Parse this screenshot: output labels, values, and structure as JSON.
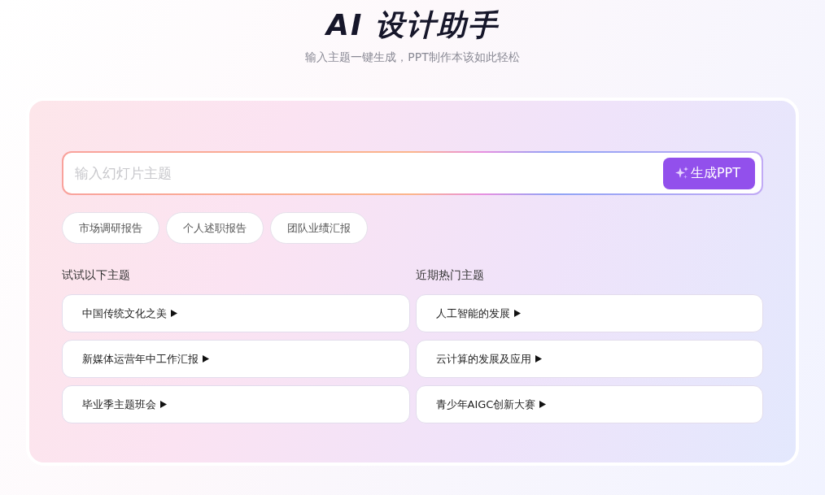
{
  "header": {
    "title": "AI 设计助手",
    "subtitle": "输入主题一键生成，PPT制作本该如此轻松"
  },
  "search": {
    "placeholder": "输入幻灯片主题",
    "button": "生成PPT"
  },
  "chips": [
    "市场调研报告",
    "个人述职报告",
    "团队业绩汇报"
  ],
  "sections": [
    {
      "title": "试试以下主题",
      "items": [
        "中国传统文化之美",
        "新媒体运营年中工作汇报",
        "毕业季主题班会"
      ]
    },
    {
      "title": "近期热门主题",
      "items": [
        "人工智能的发展",
        "云计算的发展及应用",
        "青少年AIGC创新大赛"
      ]
    }
  ]
}
